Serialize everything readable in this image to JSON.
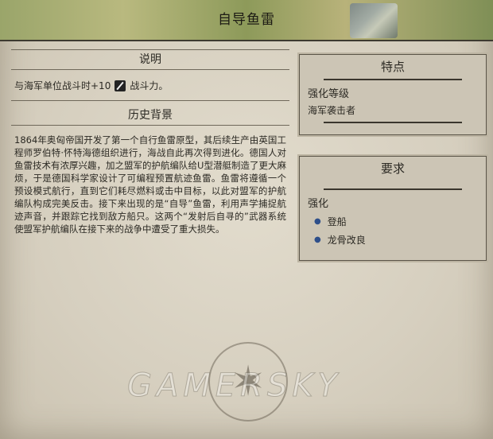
{
  "header": {
    "title": "自导鱼雷"
  },
  "description": {
    "heading": "说明",
    "effect_prefix": "与海军单位战斗时+10",
    "effect_icon": "sword-strength-icon",
    "effect_suffix": "战斗力。"
  },
  "history": {
    "heading": "历史背景",
    "text": "1864年奥匈帝国开发了第一个自行鱼雷原型，其后续生产由英国工程师罗伯特·怀特海德组织进行，海战自此再次得到进化。德国人对鱼雷技术有浓厚兴趣，加之盟军的护航编队给U型潜艇制造了更大麻烦，于是德国科学家设计了可编程预置航迹鱼雷。鱼雷将遵循一个预设模式航行，直到它们耗尽燃料或击中目标，以此对盟军的护航编队构成完美反击。接下来出现的是“自导”鱼雷，利用声学捕捉航迹声音，并跟踪它找到敌方船只。这两个“发射后自寻的”武器系统使盟军护航编队在接下来的战争中遭受了重大损失。"
  },
  "features": {
    "title": "特点",
    "label": "强化等级",
    "value": "海军袭击者"
  },
  "requirements": {
    "title": "要求",
    "label": "强化",
    "items": [
      "登船",
      "龙骨改良"
    ]
  },
  "watermark": "GAMERSKY"
}
